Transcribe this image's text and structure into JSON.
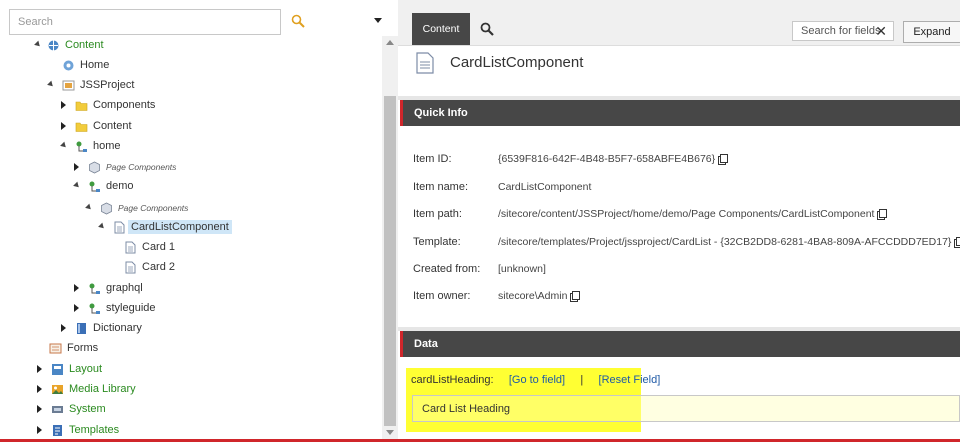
{
  "left_panel": {
    "search": {
      "placeholder": "Search",
      "value": ""
    },
    "tree": {
      "content": "Content",
      "home": "Home",
      "jssproject": "JSSProject",
      "components": "Components",
      "content2": "Content",
      "home2": "home",
      "page_components": "Page Components",
      "demo": "demo",
      "page_components2": "Page Components",
      "cardlistcomponent": "CardListComponent",
      "card1": "Card 1",
      "card2": "Card 2",
      "graphql": "graphql",
      "styleguide": "styleguide",
      "dictionary": "Dictionary",
      "forms": "Forms",
      "layout": "Layout",
      "media_library": "Media Library",
      "system": "System",
      "templates": "Templates"
    }
  },
  "toolbar": {
    "tab_content": "Content",
    "field_search_placeholder": "Search for fields",
    "expand_label": "Expand"
  },
  "editor": {
    "title": "CardListComponent",
    "quick_info": {
      "heading": "Quick Info",
      "rows": [
        {
          "label": "Item ID:",
          "value": "{6539F816-642F-4B48-B5F7-658ABFE4B676}"
        },
        {
          "label": "Item name:",
          "value": "CardListComponent"
        },
        {
          "label": "Item path:",
          "value": "/sitecore/content/JSSProject/home/demo/Page Components/CardListComponent"
        },
        {
          "label": "Template:",
          "value": "/sitecore/templates/Project/jssproject/CardList - {32CB2DD8-6281-4BA8-809A-AFCCDDD7ED17}"
        },
        {
          "label": "Created from:",
          "value": "[unknown]"
        },
        {
          "label": "Item owner:",
          "value": "sitecore\\Admin"
        }
      ]
    },
    "data_section": {
      "heading": "Data",
      "field_name": "cardListHeading:",
      "goto_link": "[Go to field]",
      "separator": "|",
      "reset_link": "[Reset Field]",
      "field_value": "Card List Heading"
    }
  },
  "colors": {
    "accent_red": "#d0262b",
    "bar_dark": "#474747",
    "highlight_yellow": "#ffff33",
    "tree_green": "#2a8a1f"
  }
}
